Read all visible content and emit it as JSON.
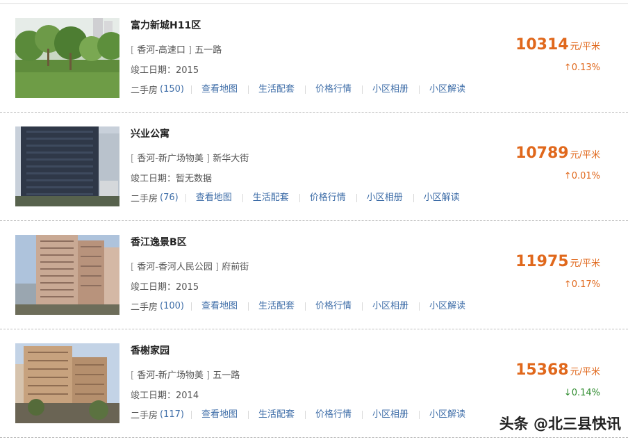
{
  "listings": [
    {
      "name": "富力新城H11区",
      "district": "香河-高速口",
      "street": "五一路",
      "built_label": "竣工日期：",
      "built_value": "2015",
      "secondhand_label": "二手房",
      "secondhand_count": "(150)",
      "links": [
        "查看地图",
        "生活配套",
        "价格行情",
        "小区相册",
        "小区解读"
      ],
      "price": "10314",
      "price_unit": "元/平米",
      "change_arrow": "↑",
      "change_value": "0.13%",
      "change_dir": "up"
    },
    {
      "name": "兴业公寓",
      "district": "香河-新广场物美",
      "street": "新华大街",
      "built_label": "竣工日期：",
      "built_value": "暂无数据",
      "secondhand_label": "二手房",
      "secondhand_count": "(76)",
      "links": [
        "查看地图",
        "生活配套",
        "价格行情",
        "小区相册",
        "小区解读"
      ],
      "price": "10789",
      "price_unit": "元/平米",
      "change_arrow": "↑",
      "change_value": "0.01%",
      "change_dir": "up"
    },
    {
      "name": "香江逸景B区",
      "district": "香河-香河人民公园",
      "street": "府前街",
      "built_label": "竣工日期：",
      "built_value": "2015",
      "secondhand_label": "二手房",
      "secondhand_count": "(100)",
      "links": [
        "查看地图",
        "生活配套",
        "价格行情",
        "小区相册",
        "小区解读"
      ],
      "price": "11975",
      "price_unit": "元/平米",
      "change_arrow": "↑",
      "change_value": "0.17%",
      "change_dir": "up"
    },
    {
      "name": "香榭家园",
      "district": "香河-新广场物美",
      "street": "五一路",
      "built_label": "竣工日期：",
      "built_value": "2014",
      "secondhand_label": "二手房",
      "secondhand_count": "(117)",
      "links": [
        "查看地图",
        "生活配套",
        "价格行情",
        "小区相册",
        "小区解读"
      ],
      "price": "15368",
      "price_unit": "元/平米",
      "change_arrow": "↓",
      "change_value": "0.14%",
      "change_dir": "down"
    }
  ],
  "watermark": "头条 @北三县快讯",
  "colors": {
    "price": "#e0681c",
    "link": "#3f6ea8",
    "down": "#2e8b2e"
  }
}
